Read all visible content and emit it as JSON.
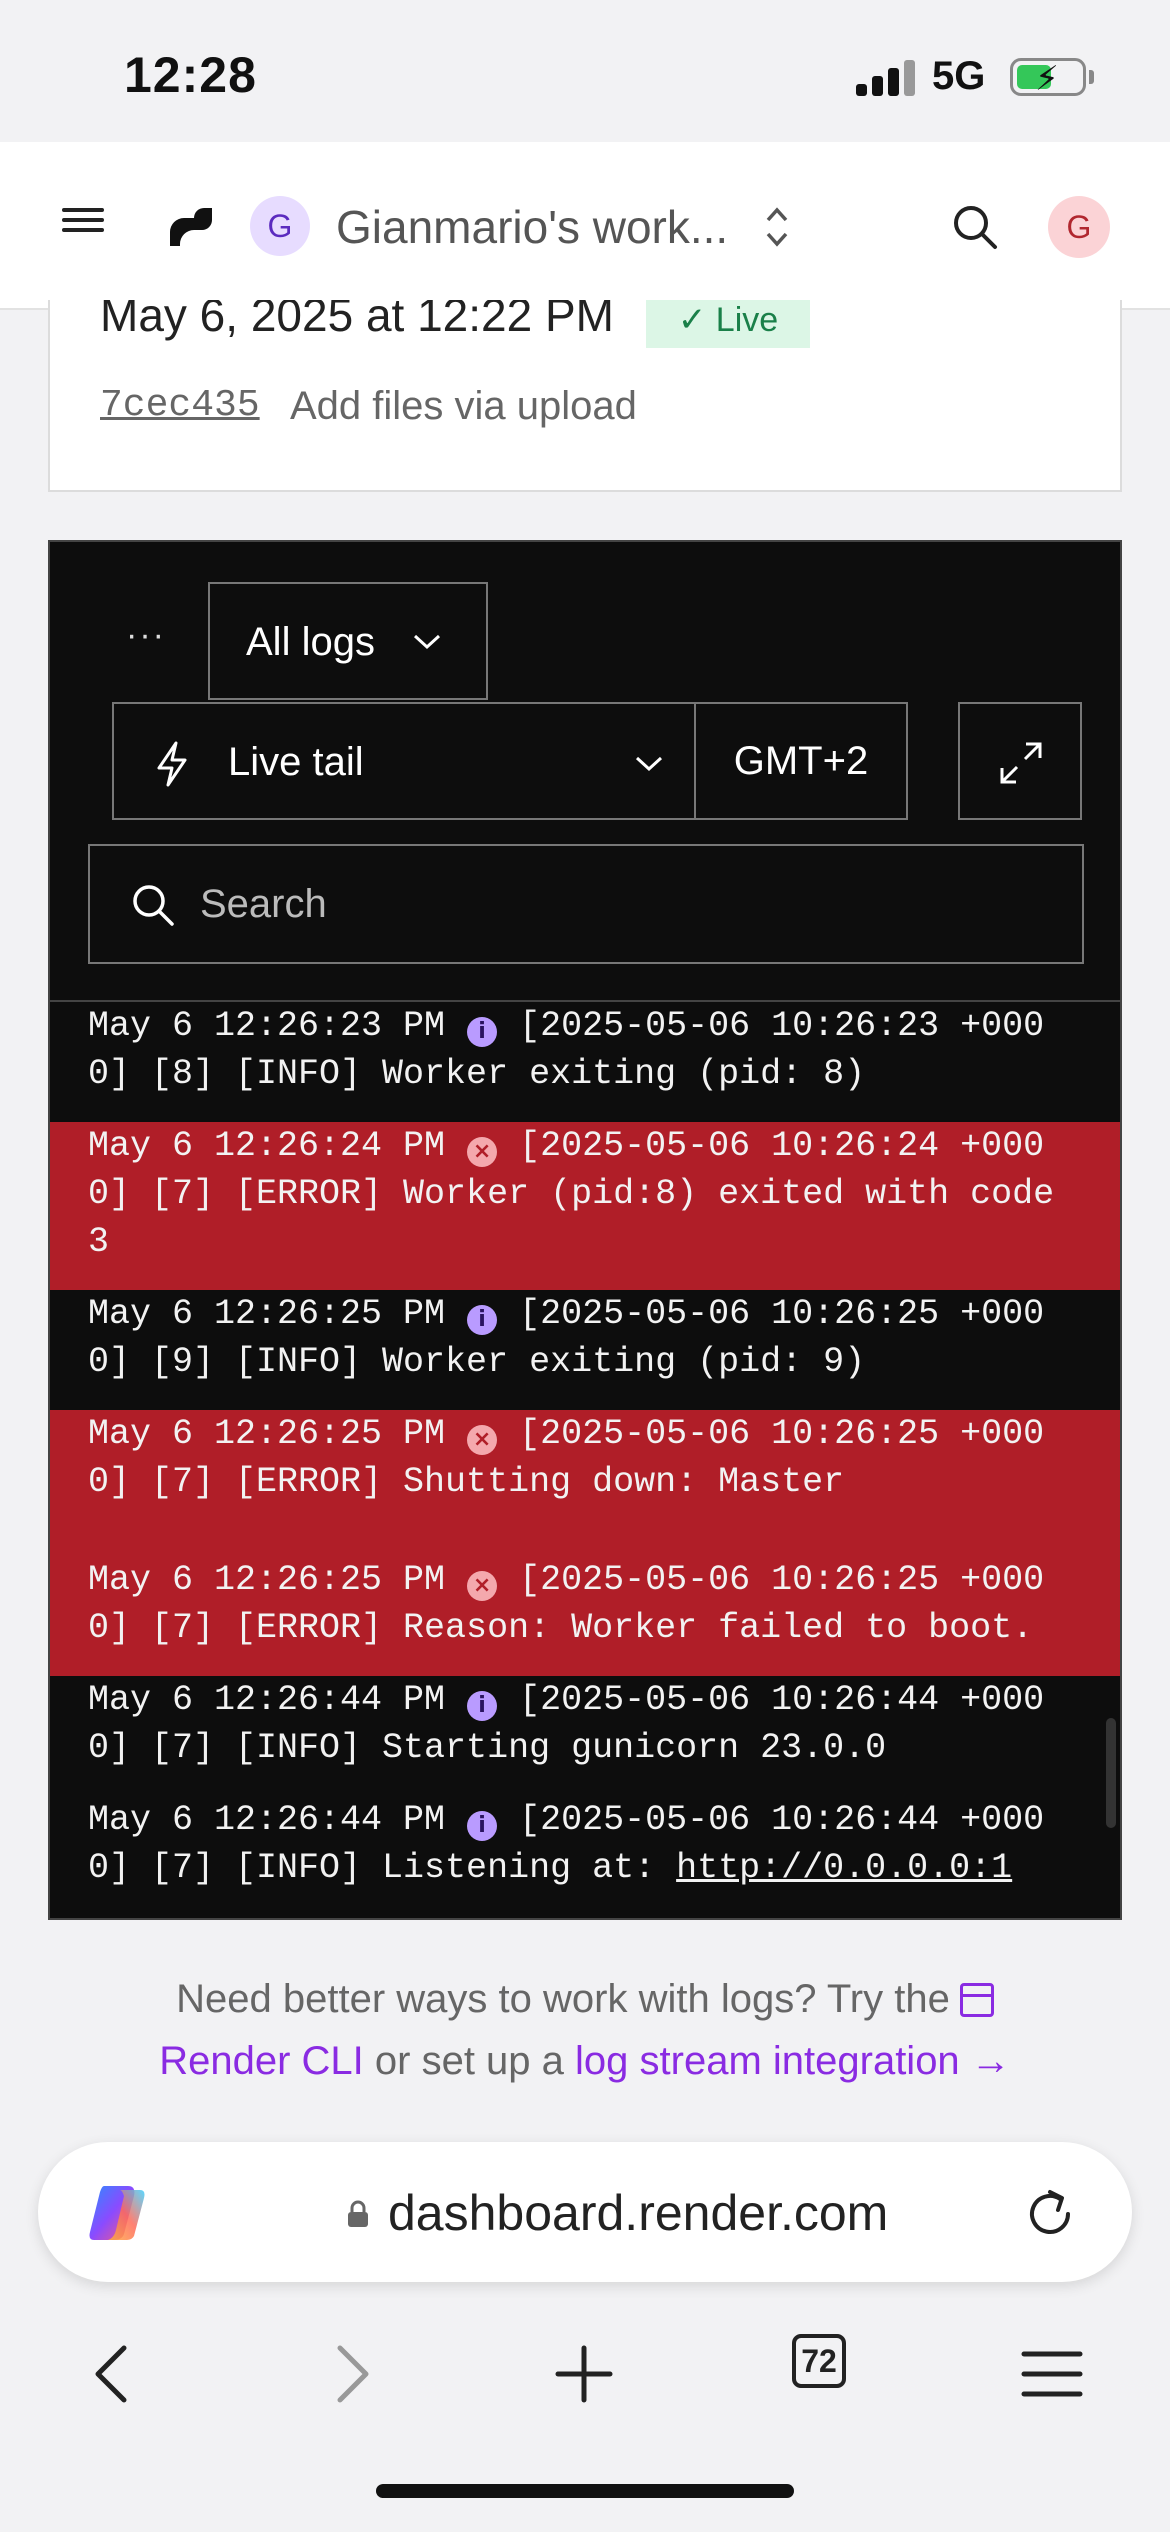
{
  "status_bar": {
    "time": "12:28",
    "network": "5G"
  },
  "header": {
    "workspace_initial": "G",
    "workspace_name": "Gianmario's work...",
    "user_initial": "G"
  },
  "deploy": {
    "date": "May 6, 2025 at 12:22 PM",
    "status": "✓ Live",
    "commit_hash": "7cec435",
    "commit_message": "Add files via upload"
  },
  "logs": {
    "more_label": "···",
    "filter_label": "All logs",
    "mode_label": "Live tail",
    "timezone_label": "GMT+2",
    "search_placeholder": "Search",
    "entries": [
      {
        "level": "info",
        "time": "May 6 12:26:23 PM",
        "message": "[2025-05-06 10:26:23 +0000] [8] [INFO] Worker exiting (pid: 8)"
      },
      {
        "level": "error",
        "time": "May 6 12:26:24 PM",
        "message": "[2025-05-06 10:26:24 +0000] [7] [ERROR] Worker (pid:8) exited with code 3"
      },
      {
        "level": "info",
        "time": "May 6 12:26:25 PM",
        "message": "[2025-05-06 10:26:25 +0000] [9] [INFO] Worker exiting (pid: 9)"
      },
      {
        "level": "error",
        "time": "May 6 12:26:25 PM",
        "message": "[2025-05-06 10:26:25 +0000] [7] [ERROR] Shutting down: Master"
      },
      {
        "level": "error",
        "time": "May 6 12:26:25 PM",
        "message": "[2025-05-06 10:26:25 +0000] [7] [ERROR] Reason: Worker failed to boot."
      },
      {
        "level": "info",
        "time": "May 6 12:26:44 PM",
        "message": "[2025-05-06 10:26:44 +0000] [7] [INFO] Starting gunicorn 23.0.0"
      },
      {
        "level": "info",
        "time": "May 6 12:26:44 PM",
        "message": "[2025-05-06 10:26:44 +0000] [7] [INFO] Listening at: ",
        "url": "http://0.0.0.0:1"
      }
    ]
  },
  "footer": {
    "text_before": "Need better ways to work with logs? Try the",
    "cli_link": "Render CLI",
    "text_middle": "or set up a",
    "stream_link": "log stream integration →"
  },
  "browser": {
    "url": "dashboard.render.com",
    "tabs_count": "72"
  },
  "colors": {
    "error_row": "#b01e28",
    "info_row": "#0d0d0d",
    "link": "#8a2be2",
    "live_badge_bg": "#dcf6e6",
    "live_badge_text": "#1a8049"
  }
}
